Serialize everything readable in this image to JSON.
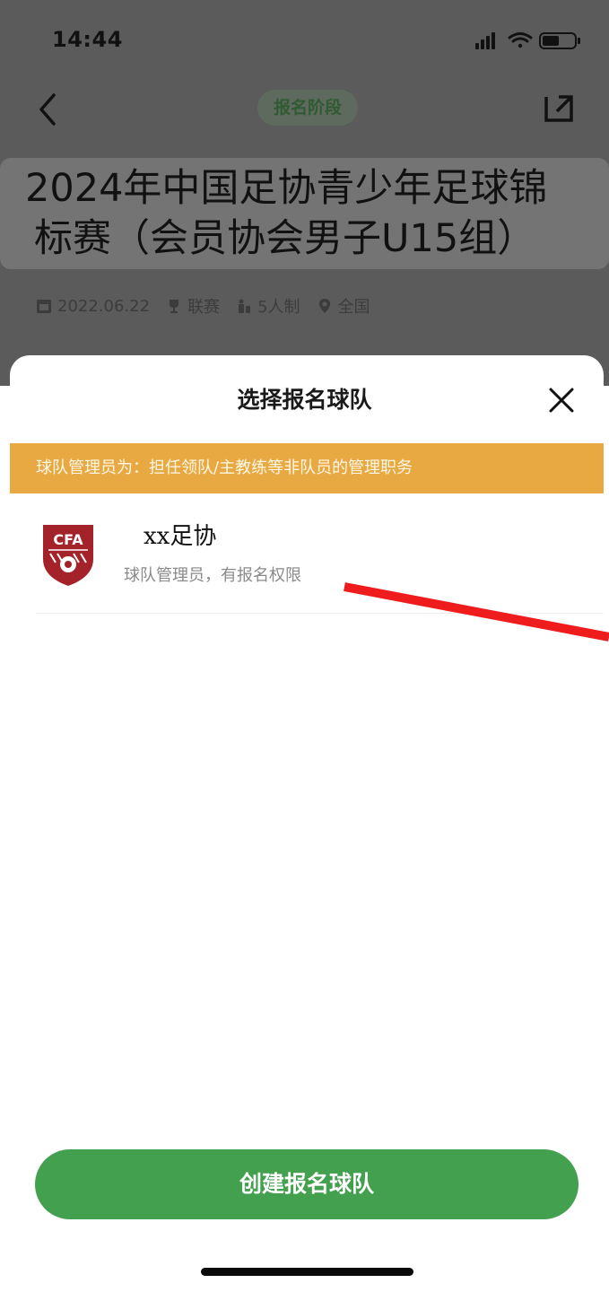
{
  "status_bar": {
    "time": "14:44",
    "icons": [
      "signal-icon",
      "wifi-icon",
      "battery-icon"
    ]
  },
  "header": {
    "stage_label": "报名阶段",
    "title_line1": "2024年中国足协青少年足球锦",
    "title_line2": "标赛（会员协会男子U15组）"
  },
  "meta": {
    "date": "2022.06.22",
    "type": "联赛",
    "format": "5人制",
    "region": "全国"
  },
  "sheet": {
    "title": "选择报名球队",
    "notice": "球队管理员为：担任领队/主教练等非队员的管理职务",
    "teams": [
      {
        "name": "xx足协",
        "role": "球队管理员，有报名权限",
        "logo_text": "CFA"
      }
    ],
    "create_button": "创建报名球队"
  },
  "colors": {
    "accent_green": "#43a04f",
    "notice_orange": "#e8a942",
    "annotation_red": "#ee1c1c"
  }
}
